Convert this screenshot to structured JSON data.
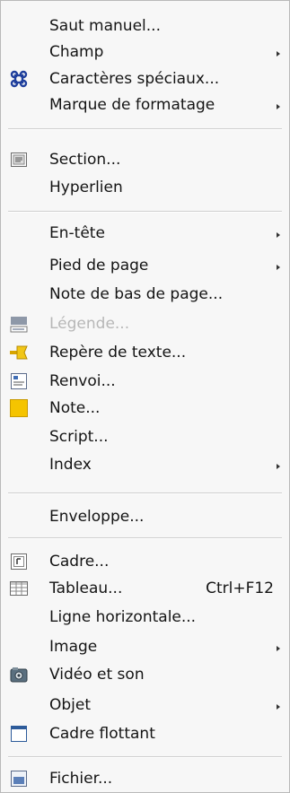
{
  "menu": {
    "items": [
      {
        "label": "Saut manuel...",
        "icon": null,
        "submenu": false
      },
      {
        "label": "Champ",
        "icon": null,
        "submenu": true
      },
      {
        "label": "Caractères spéciaux...",
        "icon": "command-icon",
        "submenu": false
      },
      {
        "label": "Marque de formatage",
        "icon": null,
        "submenu": true
      },
      {
        "label": "Section...",
        "icon": "section-icon",
        "submenu": false
      },
      {
        "label": "Hyperlien",
        "icon": null,
        "submenu": false
      },
      {
        "label": "En-tête",
        "icon": null,
        "submenu": true
      },
      {
        "label": "Pied de page",
        "icon": null,
        "submenu": true
      },
      {
        "label": "Note de bas de page...",
        "icon": null,
        "submenu": false
      },
      {
        "label": "Légende...",
        "icon": "caption-icon",
        "submenu": false,
        "disabled": true
      },
      {
        "label": "Repère de texte...",
        "icon": "bookmark-icon",
        "submenu": false
      },
      {
        "label": "Renvoi...",
        "icon": "cross-reference-icon",
        "submenu": false
      },
      {
        "label": "Note...",
        "icon": "note-icon",
        "submenu": false
      },
      {
        "label": "Script...",
        "icon": null,
        "submenu": false
      },
      {
        "label": "Index",
        "icon": null,
        "submenu": true
      },
      {
        "label": "Enveloppe...",
        "icon": null,
        "submenu": false
      },
      {
        "label": "Cadre...",
        "icon": "frame-icon",
        "submenu": false
      },
      {
        "label": "Tableau...",
        "icon": "table-icon",
        "submenu": false,
        "shortcut": "Ctrl+F12"
      },
      {
        "label": "Ligne horizontale...",
        "icon": null,
        "submenu": false
      },
      {
        "label": "Image",
        "icon": null,
        "submenu": true
      },
      {
        "label": "Vidéo et son",
        "icon": "video-sound-icon",
        "submenu": false
      },
      {
        "label": "Objet",
        "icon": null,
        "submenu": true
      },
      {
        "label": "Cadre flottant",
        "icon": "floating-frame-icon",
        "submenu": false
      },
      {
        "label": "Fichier...",
        "icon": "file-icon",
        "submenu": false
      }
    ]
  },
  "colors": {
    "menu_background": "#f7f7f7",
    "text": "#141414",
    "disabled_text": "#b7b7b7",
    "separator": "#cfcfcf",
    "note_yellow": "#f5c400",
    "command_blue": "#1f3f9c"
  }
}
